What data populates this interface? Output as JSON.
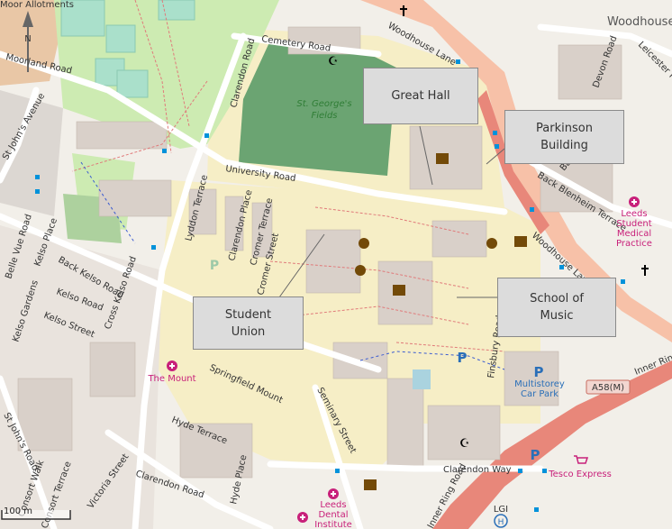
{
  "map": {
    "street_labels": [
      "Cemetery Road",
      "Woodhouse Lane",
      "Clarendon Road",
      "University Road",
      "Moorland Road",
      "St John's Avenue",
      "Back Blenheim Terrace",
      "Woodhouse Lane",
      "Lyddon Terrace",
      "Clarendon Place",
      "Cromer Terrace",
      "Cromer Street",
      "Kelso Place",
      "Back Kelso Road",
      "Kelso Road",
      "Cross Kelso Road",
      "Kelso Street",
      "Kelso Gardens",
      "Belle Vue Road",
      "Springfield Mount",
      "Seminary Street",
      "Hyde Terrace",
      "Victoria Street",
      "Clarendon Road",
      "Clarendon Way",
      "Inner Ring Road",
      "Finsbury Road",
      "St John's Road",
      "Consort Walk",
      "Consort Terrace",
      "Devon Road",
      "Leicester Place",
      "Hyde Place",
      "Back Walk",
      "Inner Ring",
      "Moor Allotments",
      "Woodhouse"
    ],
    "park_label": "St. George's\nFields",
    "poi_pink": [
      "Leeds\nStudent\nMedical\nPractice",
      "The Mount",
      "Leeds\nDental\nInstitute",
      "Tesco Express"
    ],
    "poi_blue": [
      "Multistorey\nCar Park"
    ],
    "road_ref": "A58(M)",
    "hospital_label": "LGI",
    "north_label": "N",
    "scale_label": "100 m"
  },
  "callouts": {
    "great_hall": "Great Hall",
    "parkinson": "Parkinson\nBuilding",
    "student_union": "Student\nUnion",
    "school_of_music": "School of\nMusic"
  },
  "colors": {
    "background": "#f2efe9",
    "campus": "#f6eec6",
    "park": "#6ba472",
    "pitch": "#aae0cb",
    "primary_road": "#f7c1a8",
    "trunk_road": "#e8877a",
    "building": "#d9d0c9",
    "callout_fill": "#dcdcdc"
  }
}
